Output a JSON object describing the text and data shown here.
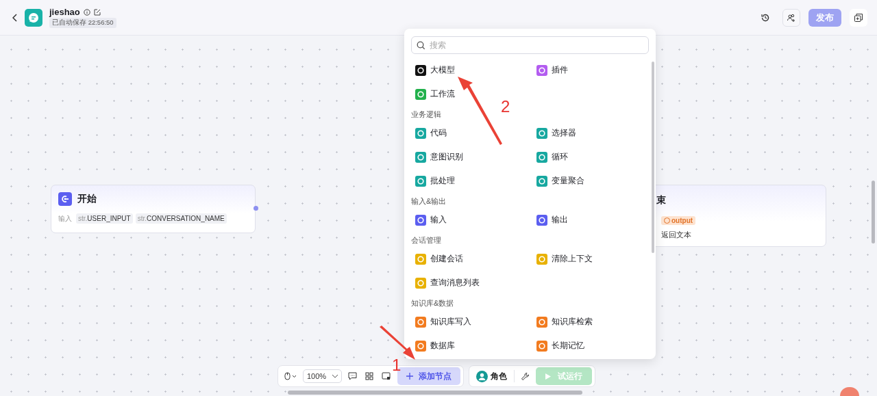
{
  "header": {
    "title": "jieshao",
    "autosave": "已自动保存 22:56:50",
    "publish": {
      "label": "发布",
      "disabled": true
    }
  },
  "start_node": {
    "title": "开始",
    "inputs_label": "输入",
    "params": [
      {
        "type": "str.",
        "name": "USER_INPUT"
      },
      {
        "type": "str.",
        "name": "CONVERSATION_NAME"
      }
    ]
  },
  "end_node": {
    "title": "束",
    "output_tag": "output",
    "description": "返回文本"
  },
  "node_menu": {
    "search": {
      "placeholder": "搜索"
    },
    "sections": [
      {
        "items": [
          {
            "label": "大模型",
            "color": "#111111"
          },
          {
            "label": "插件",
            "color": "#b35cf0"
          },
          {
            "label": "工作流",
            "color": "#22b14c"
          }
        ]
      },
      {
        "heading": "业务逻辑",
        "items": [
          {
            "label": "代码",
            "color": "#17a8a0"
          },
          {
            "label": "选择器",
            "color": "#17a8a0"
          },
          {
            "label": "意图识别",
            "color": "#17a8a0"
          },
          {
            "label": "循环",
            "color": "#17a8a0"
          },
          {
            "label": "批处理",
            "color": "#17a8a0"
          },
          {
            "label": "变量聚合",
            "color": "#17a8a0"
          }
        ]
      },
      {
        "heading": "输入&输出",
        "items": [
          {
            "label": "输入",
            "color": "#5b5ef0"
          },
          {
            "label": "输出",
            "color": "#5b5ef0"
          }
        ]
      },
      {
        "heading": "会话管理",
        "items": [
          {
            "label": "创建会话",
            "color": "#e8b100"
          },
          {
            "label": "清除上下文",
            "color": "#e8b100"
          },
          {
            "label": "查询消息列表",
            "color": "#e8b100"
          }
        ]
      },
      {
        "heading": "知识库&数据",
        "items": [
          {
            "label": "知识库写入",
            "color": "#f27b1f"
          },
          {
            "label": "知识库检索",
            "color": "#f27b1f"
          },
          {
            "label": "数据库",
            "color": "#f27b1f"
          },
          {
            "label": "长期记忆",
            "color": "#f27b1f"
          }
        ]
      }
    ]
  },
  "toolbar": {
    "zoom": "100%",
    "add_node": "添加节点",
    "role": "角色",
    "run": {
      "label": "试运行",
      "disabled": true
    }
  },
  "annotations": [
    {
      "label": "1"
    },
    {
      "label": "2"
    }
  ]
}
